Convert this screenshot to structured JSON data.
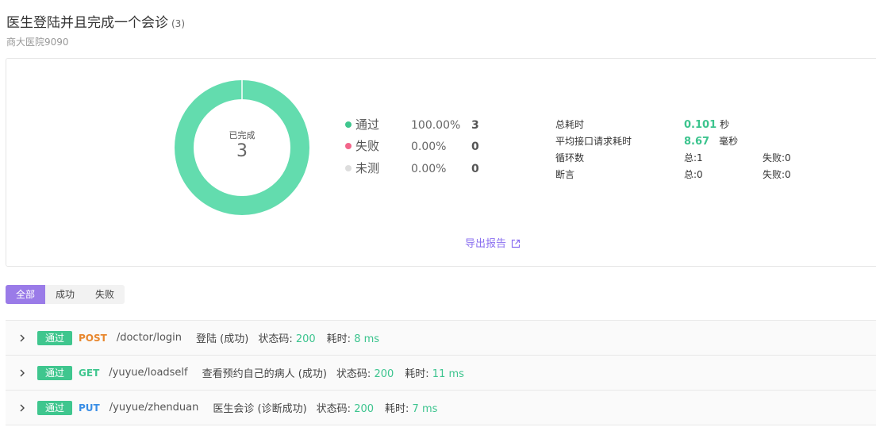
{
  "header": {
    "title": "医生登陆并且完成一个会诊",
    "count": "(3)",
    "subtitle": "商大医院9090"
  },
  "summary": {
    "donut": {
      "label": "已完成",
      "total": "3",
      "passed": 3,
      "failed": 0,
      "untested": 0,
      "colors": {
        "passed": "#63dcae",
        "failed": "#f2668b",
        "untested": "#dddddd"
      }
    },
    "legend": [
      {
        "label": "通过",
        "pct": "100.00%",
        "count": "3",
        "color": "#3fc68e"
      },
      {
        "label": "失败",
        "pct": "0.00%",
        "count": "0",
        "color": "#f2668b"
      },
      {
        "label": "未测",
        "pct": "0.00%",
        "count": "0",
        "color": "#dddddd"
      }
    ],
    "stats": {
      "total_time_label": "总耗时",
      "total_time_value": "0.101",
      "total_time_unit": "秒",
      "avg_label": "平均接口请求耗时",
      "avg_value": "8.67",
      "avg_unit": "毫秒",
      "loop_label": "循环数",
      "loop_total": "总:1",
      "loop_failed": "失败:0",
      "assert_label": "断言",
      "assert_total": "总:0",
      "assert_failed": "失败:0"
    },
    "export_label": "导出报告"
  },
  "filter_tabs": [
    "全部",
    "成功",
    "失败"
  ],
  "requests": [
    {
      "status": "通过",
      "method": "POST",
      "method_color": "#e8872e",
      "path": "/doctor/login",
      "name": "登陆 (成功)",
      "code_label": "状态码:",
      "code": "200",
      "time_label": "耗时:",
      "time": "8 ms"
    },
    {
      "status": "通过",
      "method": "GET",
      "method_color": "#3fc68e",
      "path": "/yuyue/loadself",
      "name": "查看预约自己的病人 (成功)",
      "code_label": "状态码:",
      "code": "200",
      "time_label": "耗时:",
      "time": "11 ms"
    },
    {
      "status": "通过",
      "method": "PUT",
      "method_color": "#3a8ee6",
      "path": "/yuyue/zhenduan",
      "name": "医生会诊 (诊断成功)",
      "code_label": "状态码:",
      "code": "200",
      "time_label": "耗时:",
      "time": "7 ms"
    }
  ]
}
